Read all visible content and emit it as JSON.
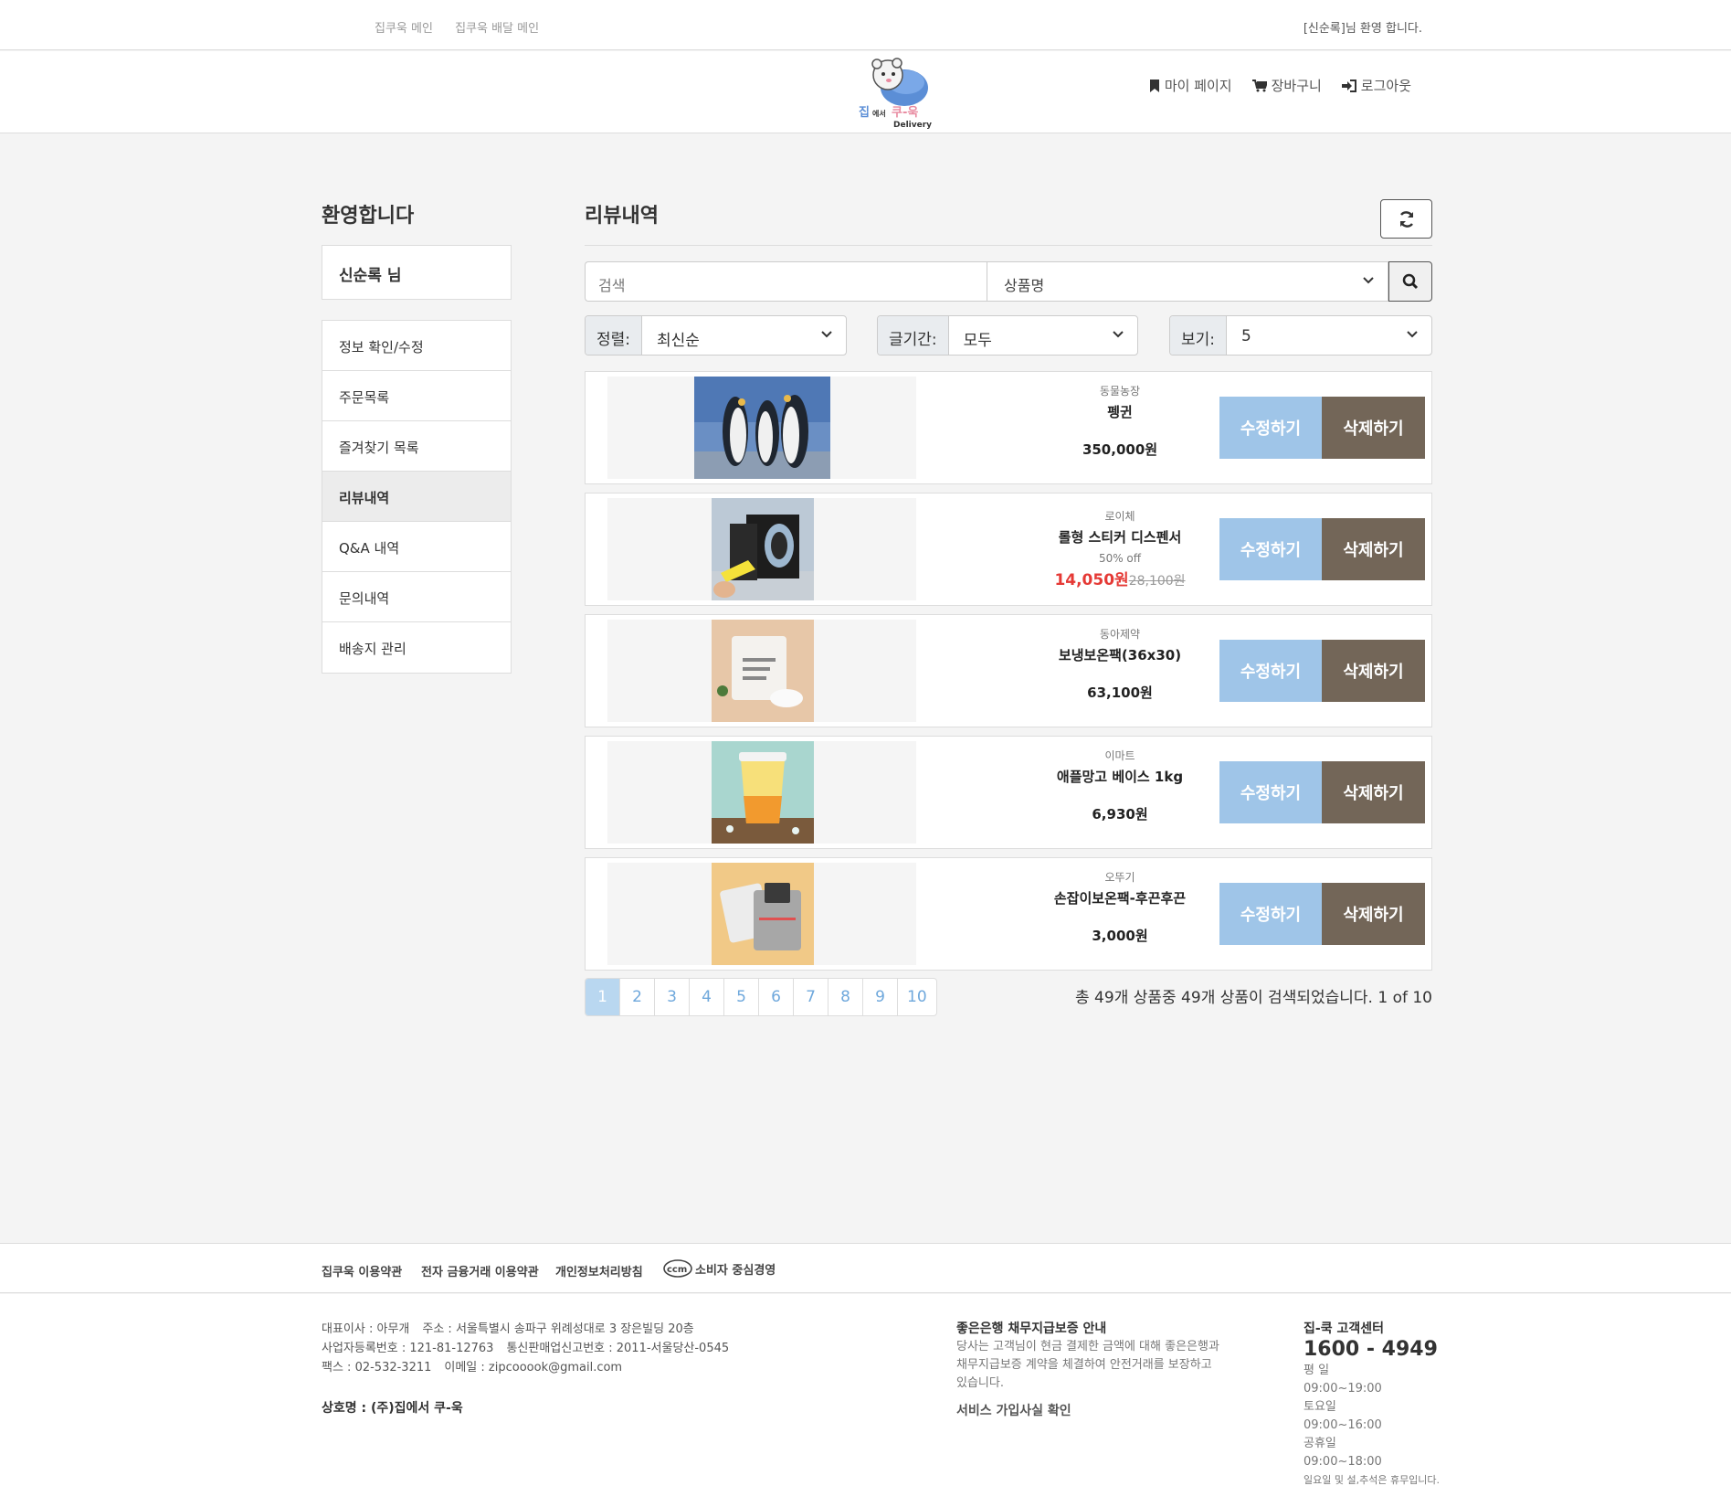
{
  "topbar": {
    "links": [
      "집쿠욱 메인",
      "집쿠욱 배달 메인"
    ],
    "welcome": "[신순록]님 환영 합니다."
  },
  "header": {
    "logo_text": "집에서 쿠-욱",
    "logo_sub": "Delivery",
    "nav": [
      {
        "label": "마이 페이지",
        "icon": "bookmark-icon"
      },
      {
        "label": "장바구니",
        "icon": "cart-icon"
      },
      {
        "label": "로그아웃",
        "icon": "sign-out-icon"
      }
    ]
  },
  "sidebar": {
    "title": "환영합니다",
    "user": "신순록 님",
    "menu": [
      "정보 확인/수정",
      "주문목록",
      "즐겨찾기 목록",
      "리뷰내역",
      "Q&A 내역",
      "문의내역",
      "배송지 관리"
    ],
    "active_index": 3
  },
  "main": {
    "title": "리뷰내역",
    "search": {
      "placeholder": "검색",
      "field": "상품명"
    },
    "filters": [
      {
        "label": "정렬:",
        "value": "최신순"
      },
      {
        "label": "글기간:",
        "value": "모두"
      },
      {
        "label": "보기:",
        "value": "5"
      }
    ],
    "buttons": {
      "edit": "수정하기",
      "delete": "삭제하기"
    },
    "items": [
      {
        "brand": "동물농장",
        "name": "펭귄",
        "price": "350,000원"
      },
      {
        "brand": "로이체",
        "name": "롤형 스티커 디스펜서",
        "discount": "50% off",
        "sale_price": "14,050원",
        "orig_price": "28,100원"
      },
      {
        "brand": "동아제약",
        "name": "보냉보온팩(36x30)",
        "price": "63,100원"
      },
      {
        "brand": "이마트",
        "name": "애플망고 베이스 1kg",
        "price": "6,930원"
      },
      {
        "brand": "오뚜기",
        "name": "손잡이보온팩-후끈후끈",
        "price": "3,000원"
      }
    ],
    "pages": [
      "1",
      "2",
      "3",
      "4",
      "5",
      "6",
      "7",
      "8",
      "9",
      "10"
    ],
    "current_page": "1",
    "result_info": "총 49개 상품중 49개 상품이 검색되었습니다. 1 of 10"
  },
  "footer": {
    "links": [
      "집쿠욱 이용약관",
      "전자 금융거래 이용약관",
      "개인정보처리방침",
      "소비자 중심경영"
    ],
    "ccm_logo": "ccm",
    "company": {
      "line1": [
        "대표이사 : 아무개",
        "주소 : 서울특별시 송파구 위례성대로 3 장은빌딩 20층"
      ],
      "line2": [
        "사업자등록번호 : 121-81-12763",
        "통신판매업신고번호 : 2011-서울당산-0545"
      ],
      "line3": [
        "팩스 : 02-532-3211",
        "이메일 : zipcooook@gmail.com"
      ],
      "corp_name": "상호명 : (주)집에서 쿠-욱"
    },
    "guarantee": {
      "title": "좋은은행 채무지급보증 안내",
      "text": "당사는 고객님이 현금 결제한 금액에 대해 좋은은행과 채무지급보증 계약을 체결하여 안전거래를 보장하고 있습니다.",
      "link": "서비스 가입사실 확인"
    },
    "cs": {
      "title": "집-쿡 고객센터",
      "tel": "1600 - 4949",
      "hours": [
        "평 일",
        "09:00~19:00",
        "토요일",
        "09:00~16:00",
        "공휴일",
        "09:00~18:00"
      ],
      "note": "일요일 및 설,추석은 휴무입니다."
    }
  },
  "colors": {
    "edit": "#9fc5e8",
    "delete": "#736658",
    "sale": "#e53935",
    "page_active": "#b9d7f0"
  }
}
